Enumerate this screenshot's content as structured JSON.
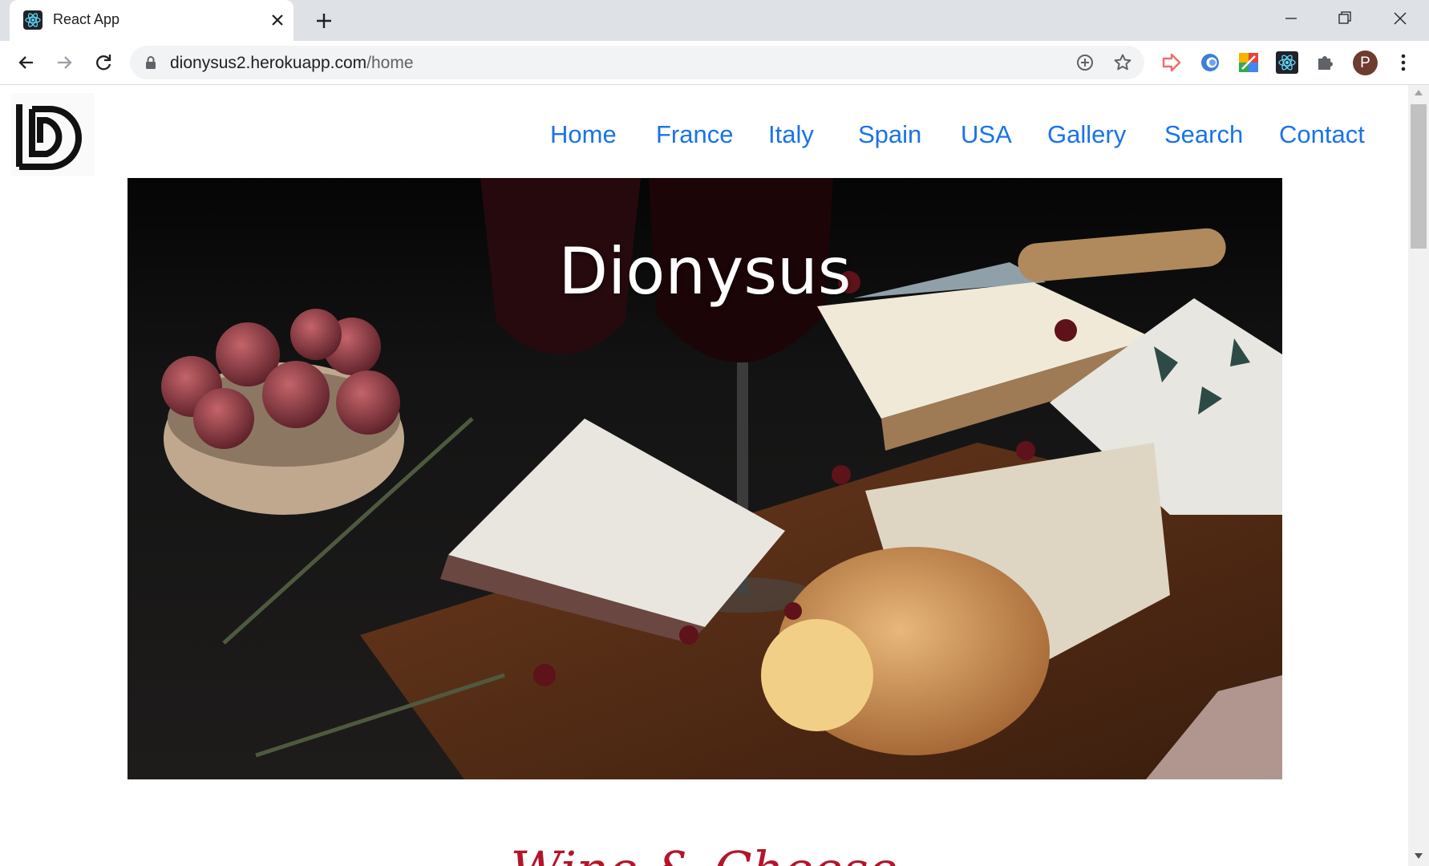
{
  "browser": {
    "tab_title": "React App",
    "url_host": "dionysus2.herokuapp.com",
    "url_path": "/home",
    "profile_initial": "P"
  },
  "site": {
    "nav": [
      {
        "label": "Home"
      },
      {
        "label": "France"
      },
      {
        "label": "Italy"
      },
      {
        "label": "Spain"
      },
      {
        "label": "USA"
      },
      {
        "label": "Gallery"
      },
      {
        "label": "Search"
      },
      {
        "label": "Contact"
      }
    ],
    "hero_title": "Dionysus",
    "section_heading": "Wine & Cheese"
  },
  "colors": {
    "nav_link": "#1a73e8",
    "heading": "#b3152a",
    "tabstrip": "#dee1e6"
  }
}
